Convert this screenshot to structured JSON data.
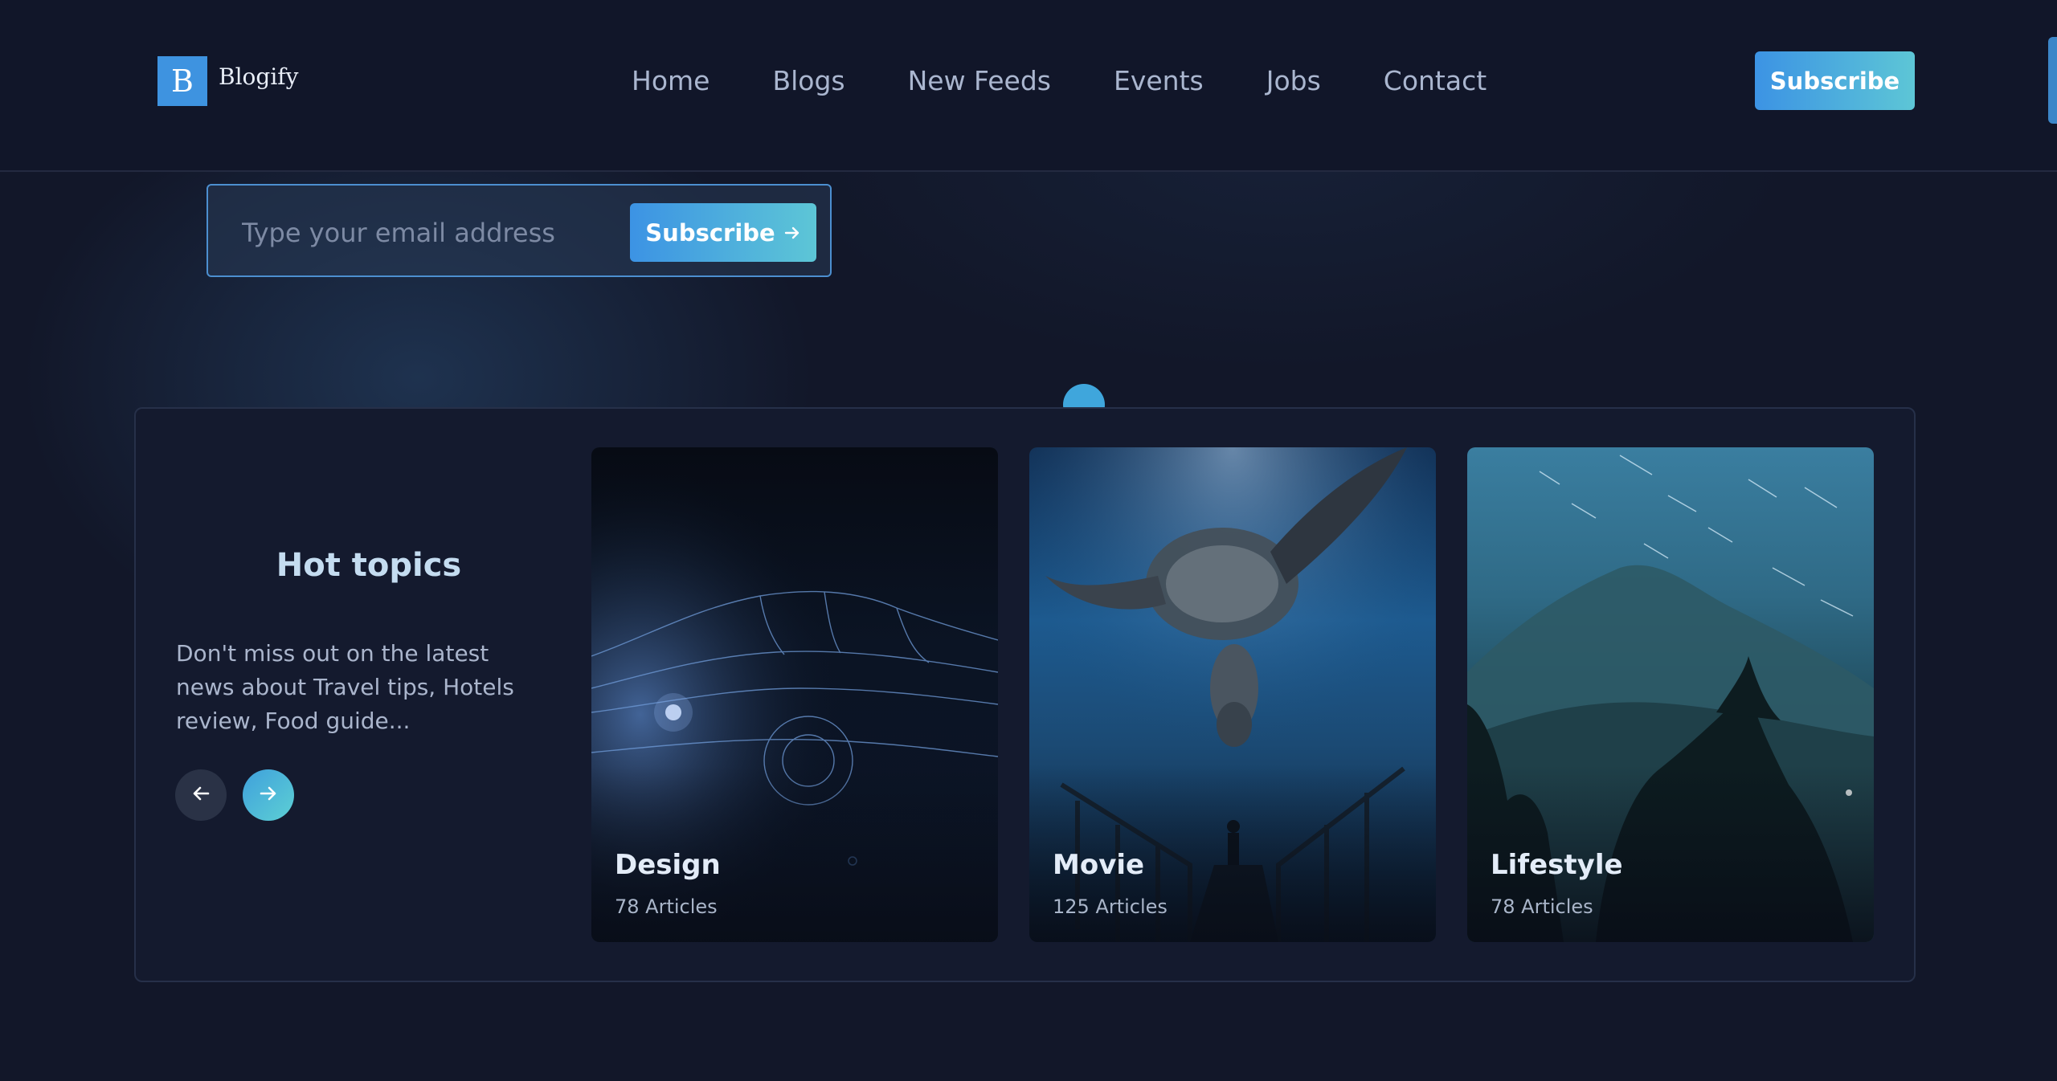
{
  "brand": {
    "logo_letter": "B",
    "name": "Blogify"
  },
  "nav": {
    "items": [
      {
        "label": "Home"
      },
      {
        "label": "Blogs"
      },
      {
        "label": "New Feeds"
      },
      {
        "label": "Events"
      },
      {
        "label": "Jobs"
      },
      {
        "label": "Contact"
      }
    ],
    "subscribe_label": "Subscribe"
  },
  "newsletter": {
    "email_placeholder": "Type your email address",
    "email_value": "",
    "submit_label": "Subscribe"
  },
  "hot_topics": {
    "title": "Hot topics",
    "description": "Don't miss out on the latest news about Travel tips, Hotels review, Food guide...",
    "cards": [
      {
        "title": "Design",
        "count": "78 Articles",
        "image": "wireframe-car"
      },
      {
        "title": "Movie",
        "count": "125 Articles",
        "image": "sea-turtle"
      },
      {
        "title": "Lifestyle",
        "count": "78 Articles",
        "image": "mountain-night"
      }
    ]
  },
  "colors": {
    "background": "#121729",
    "accent_start": "#3c93e4",
    "accent_end": "#5dc6d6",
    "panel_border": "#263049"
  },
  "icons": {
    "prev": "arrow-left-icon",
    "next": "arrow-right-icon",
    "submit": "arrow-right-icon"
  }
}
